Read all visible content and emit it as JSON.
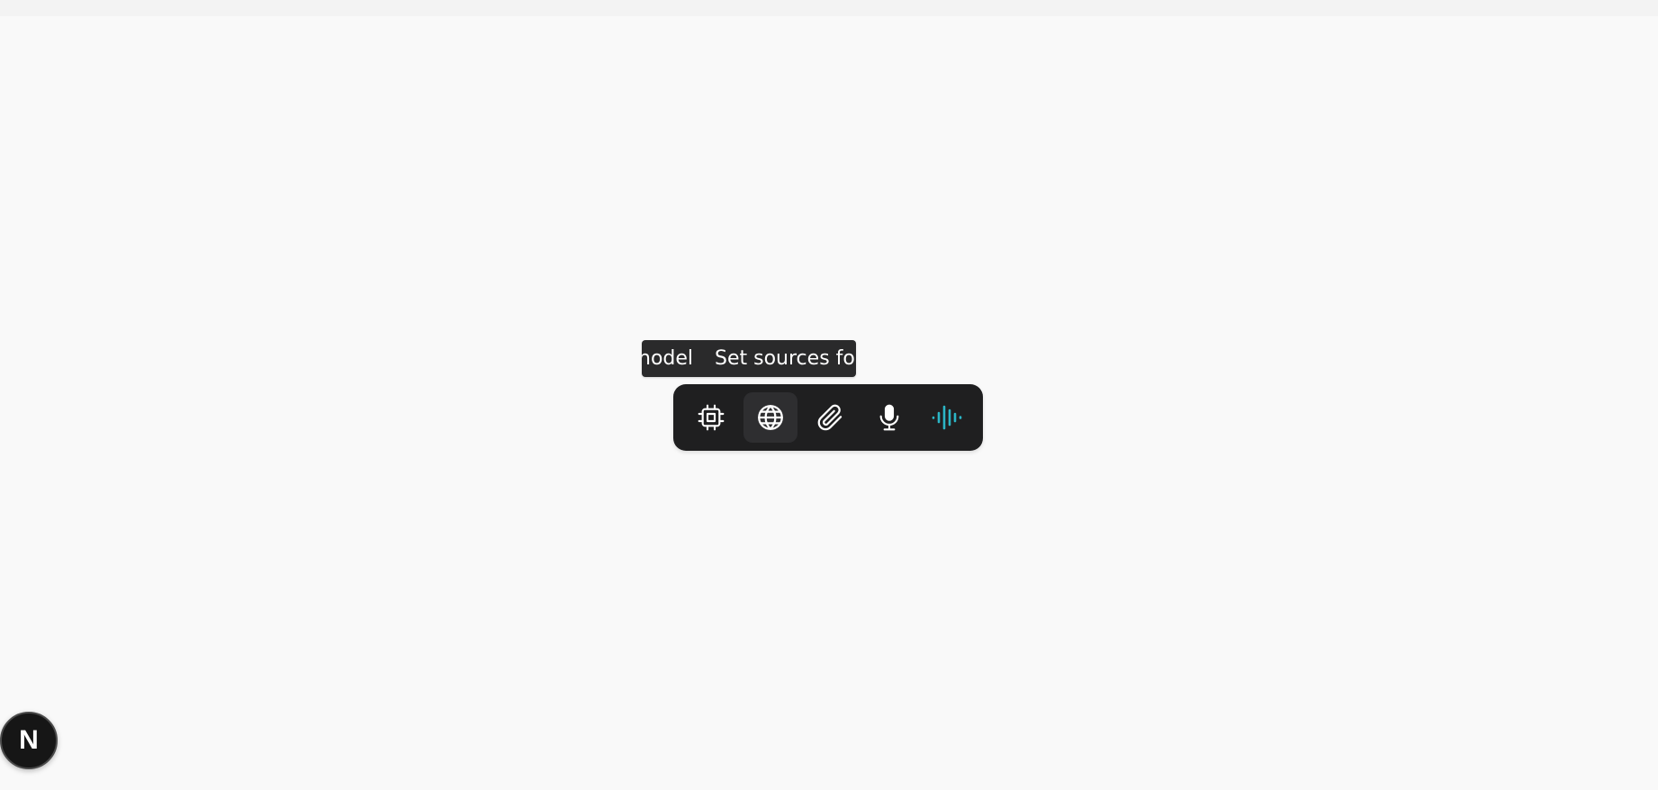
{
  "tooltip": {
    "segments": [
      "nodel",
      "Set sources for"
    ]
  },
  "toolbar": {
    "buttons": [
      {
        "icon": "cpu-chip-icon",
        "name": "model-button",
        "active": false
      },
      {
        "icon": "globe-icon",
        "name": "sources-button",
        "active": true
      },
      {
        "icon": "paperclip-icon",
        "name": "attach-button",
        "active": false
      },
      {
        "icon": "microphone-icon",
        "name": "voice-input-button",
        "active": false
      },
      {
        "icon": "sound-wave-icon",
        "name": "voice-mode-button",
        "active": false,
        "color": "#2bb6c6"
      }
    ]
  },
  "badge": {
    "letter": "N"
  },
  "colors": {
    "background": "#f9f9f9",
    "toolbar": "#1f1f20",
    "tooltip": "#2a2a2b",
    "accent": "#2bb6c6"
  }
}
